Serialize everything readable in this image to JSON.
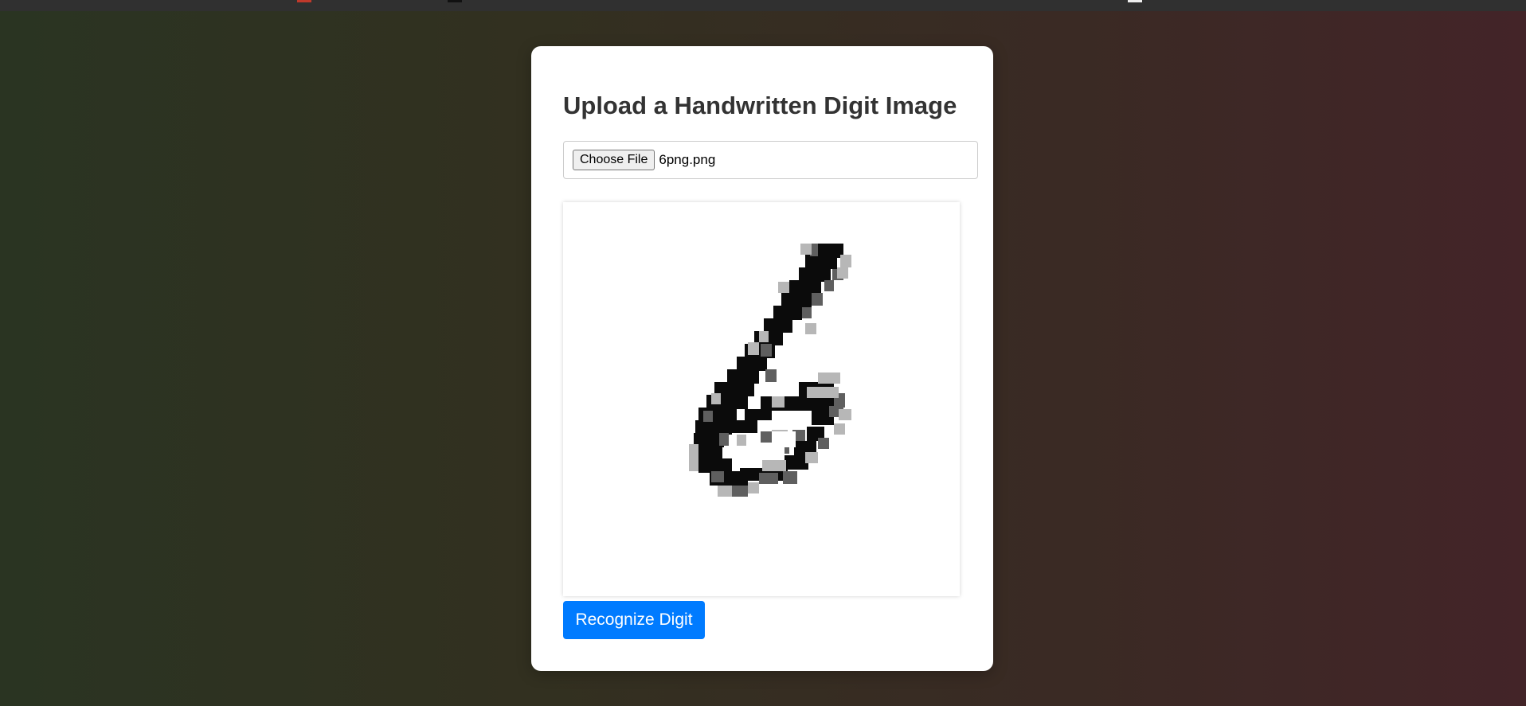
{
  "colors": {
    "accent": "#007bff",
    "card_background": "#ffffff",
    "title_color": "#333333"
  },
  "upload": {
    "title": "Upload a Handwritten Digit Image",
    "choose_file_label": "Choose File",
    "selected_file_name": "6png.png"
  },
  "preview": {
    "image_name": "handwritten-digit-six-image"
  },
  "actions": {
    "recognize_label": "Recognize Digit"
  }
}
